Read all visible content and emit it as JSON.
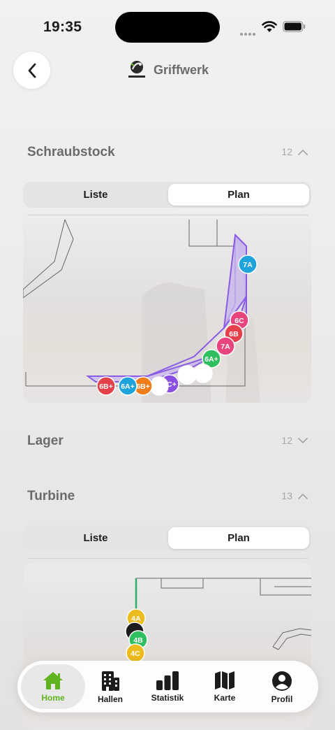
{
  "status_bar": {
    "time": "19:35"
  },
  "header": {
    "brand_name": "Griffwerk",
    "logo_text": "GRIFFWERK"
  },
  "sections": [
    {
      "title": "Schraubstock",
      "count": "12",
      "expanded": true,
      "segments": {
        "list_label": "Liste",
        "plan_label": "Plan",
        "selected": "Plan"
      },
      "routes": [
        {
          "grade": "7A",
          "color": "#1fa3dc"
        },
        {
          "grade": "6C",
          "color": "#e8457e"
        },
        {
          "grade": "6B",
          "color": "#e4404a"
        },
        {
          "grade": "7A",
          "color": "#e8457e"
        },
        {
          "grade": "6A+",
          "color": "#2fbf5f"
        },
        {
          "grade": "",
          "color": "#ffffff"
        },
        {
          "grade": "",
          "color": "#ffffff"
        },
        {
          "grade": "7C+",
          "color": "#8a4fe0"
        },
        {
          "grade": "",
          "color": "#ffffff"
        },
        {
          "grade": "6B+",
          "color": "#ef7d1a"
        },
        {
          "grade": "6A+",
          "color": "#1fa3dc"
        },
        {
          "grade": "6B+",
          "color": "#e4404a"
        }
      ]
    },
    {
      "title": "Lager",
      "count": "12",
      "expanded": false
    },
    {
      "title": "Turbine",
      "count": "13",
      "expanded": true,
      "segments": {
        "list_label": "Liste",
        "plan_label": "Plan",
        "selected": "Plan"
      },
      "routes": [
        {
          "grade": "4A",
          "color": "#ecbb1e"
        },
        {
          "grade": "",
          "color": "#1c1c1e"
        },
        {
          "grade": "4B",
          "color": "#2fbf5f"
        },
        {
          "grade": "4C",
          "color": "#ecbb1e"
        }
      ]
    }
  ],
  "tab_bar": {
    "items": [
      {
        "label": "Home",
        "icon": "home-icon",
        "active": true
      },
      {
        "label": "Hallen",
        "icon": "building-icon",
        "active": false
      },
      {
        "label": "Statistik",
        "icon": "bar-chart-icon",
        "active": false
      },
      {
        "label": "Karte",
        "icon": "map-icon",
        "active": false
      },
      {
        "label": "Profil",
        "icon": "profile-icon",
        "active": false
      }
    ],
    "active_color": "#5fb31e"
  }
}
